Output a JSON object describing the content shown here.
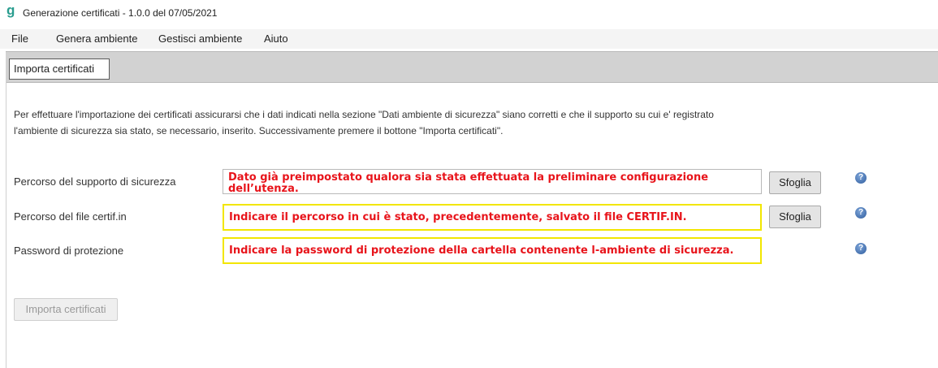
{
  "window": {
    "logo_glyph": "g",
    "title": "Generazione certificati - 1.0.0 del 07/05/2021"
  },
  "menu": [
    "File",
    "Genera ambiente",
    "Gestisci ambiente",
    "Aiuto"
  ],
  "tab": {
    "label": "Importa certificati"
  },
  "description": {
    "line1": "Per effettuare l'importazione dei certificati assicurarsi che i dati indicati nella sezione \"Dati ambiente di sicurezza\" siano corretti e che il supporto su cui e' registrato",
    "line2": "l'ambiente di sicurezza sia stato, se necessario, inserito. Successivamente premere il bottone \"Importa certificati\"."
  },
  "form": {
    "rows": [
      {
        "label": "Percorso del supporto di sicurezza",
        "hint_line1": "Dato già preimpostato qualora sia stata effettuata la preliminare configurazione",
        "hint_line2": "dell’utenza.",
        "button": "Sfoglia"
      },
      {
        "label": "Percorso del file certif.in",
        "hint_line1": "Indicare il percorso in cui è stato, precedentemente, salvato il file CERTIF.IN.",
        "button": "Sfoglia"
      },
      {
        "label": "Password di protezione",
        "hint_line1": "Indicare la password di protezione della cartella contenente l-ambiente di sicurezza."
      }
    ],
    "help_glyph": "?"
  },
  "import_button": "Importa certificati",
  "colors": {
    "hint_text": "#e8141b",
    "highlight_border": "#f2e600",
    "tabstrip": "#d2d2d2"
  }
}
